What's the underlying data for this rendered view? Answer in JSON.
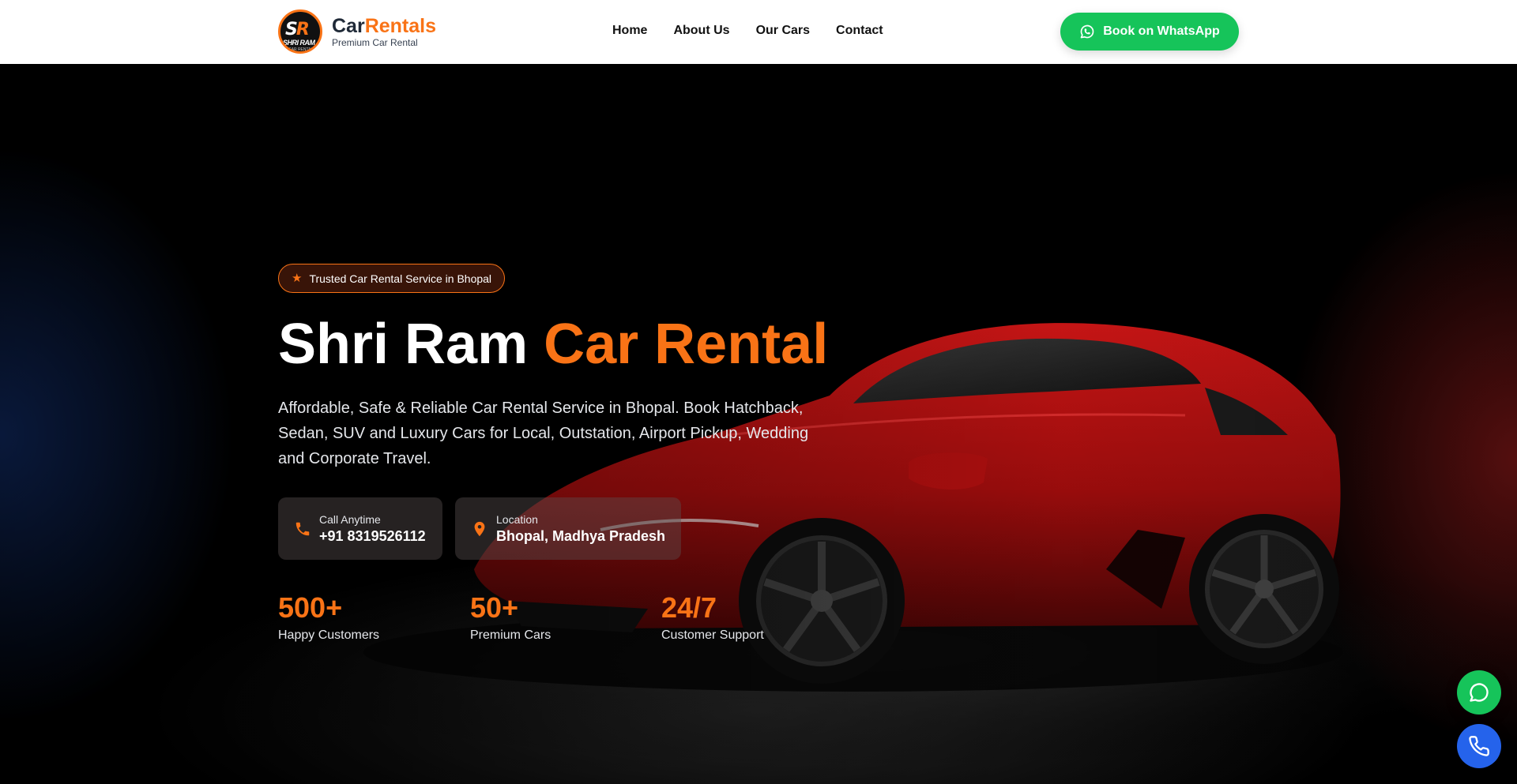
{
  "brand": {
    "logo_initials_a": "S",
    "logo_initials_b": "R",
    "logo_badge_text": "SHRI RAM",
    "logo_badge_small": "CAR RENTAL",
    "title_part1": "Car",
    "title_part2": "Rentals",
    "subtitle": "Premium Car Rental"
  },
  "nav": {
    "items": [
      {
        "label": "Home"
      },
      {
        "label": "About Us"
      },
      {
        "label": "Our Cars"
      },
      {
        "label": "Contact"
      }
    ],
    "cta_label": "Book on WhatsApp"
  },
  "hero": {
    "badge": "Trusted Car Rental Service in Bhopal",
    "title_part1": "Shri Ram ",
    "title_part2": "Car Rental",
    "description": "Affordable, Safe & Reliable Car Rental Service in Bhopal. Book Hatchback, Sedan, SUV and Luxury Cars for Local, Outstation, Airport Pickup, Wedding and Corporate Travel.",
    "call": {
      "label": "Call Anytime",
      "value": "+91 8319526112"
    },
    "location": {
      "label": "Location",
      "value": "Bhopal, Madhya Pradesh"
    },
    "stats": [
      {
        "value": "500+",
        "label": "Happy Customers"
      },
      {
        "value": "50+",
        "label": "Premium Cars"
      },
      {
        "value": "24/7",
        "label": "Customer Support"
      }
    ]
  },
  "floating": {
    "whatsapp_icon": "whatsapp-icon",
    "phone_icon": "phone-icon"
  },
  "colors": {
    "accent": "#f97316",
    "whatsapp": "#16c45a",
    "call": "#2563eb"
  }
}
